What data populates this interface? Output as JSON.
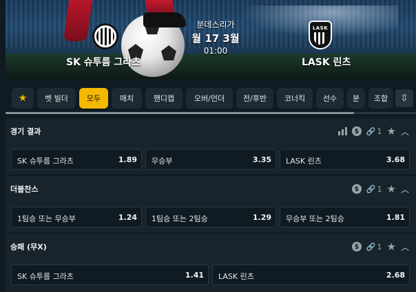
{
  "match": {
    "league": "분데스리가",
    "date": "월 17 3월",
    "time": "01:00",
    "home_team": "SK 슈투름 그라츠",
    "away_team": "LASK 린츠",
    "away_logo_text": "LASK"
  },
  "tabs": [
    {
      "label": "★",
      "active": false
    },
    {
      "label": "벳 빌더",
      "active": false
    },
    {
      "label": "모두",
      "active": true
    },
    {
      "label": "매치",
      "active": false
    },
    {
      "label": "핸디캡",
      "active": false
    },
    {
      "label": "오버/언더",
      "active": false
    },
    {
      "label": "전/후반",
      "active": false
    },
    {
      "label": "코너킥",
      "active": false
    },
    {
      "label": "선수",
      "active": false
    },
    {
      "label": "분",
      "active": false
    },
    {
      "label": "조합",
      "active": false
    }
  ],
  "markets": [
    {
      "title": "경기 결과",
      "has_stats": true,
      "link_count": "1",
      "selections": [
        {
          "label": "SK 슈투름 그라츠",
          "odds": "1.89"
        },
        {
          "label": "무승부",
          "odds": "3.35"
        },
        {
          "label": "LASK 린츠",
          "odds": "3.68"
        }
      ]
    },
    {
      "title": "더블찬스",
      "has_stats": false,
      "link_count": "1",
      "selections": [
        {
          "label": "1팀승 또는 무승부",
          "odds": "1.24"
        },
        {
          "label": "1팀승 또는 2팀승",
          "odds": "1.29"
        },
        {
          "label": "무승부 또는 2팀승",
          "odds": "1.81"
        }
      ]
    },
    {
      "title": "승패 (무X)",
      "has_stats": false,
      "link_count": "1",
      "selections": [
        {
          "label": "SK 슈투름 그라츠",
          "odds": "1.41"
        },
        {
          "label": "LASK 린츠",
          "odds": "2.68"
        }
      ]
    }
  ],
  "icons": {
    "stats": "bar-chart-icon",
    "cashout": "dollar-icon",
    "link": "link-icon",
    "favorite": "star-icon",
    "collapse": "chevron-up-icon"
  },
  "colors": {
    "accent": "#f5b800",
    "background": "#0f1a22",
    "panel": "#18232c"
  }
}
